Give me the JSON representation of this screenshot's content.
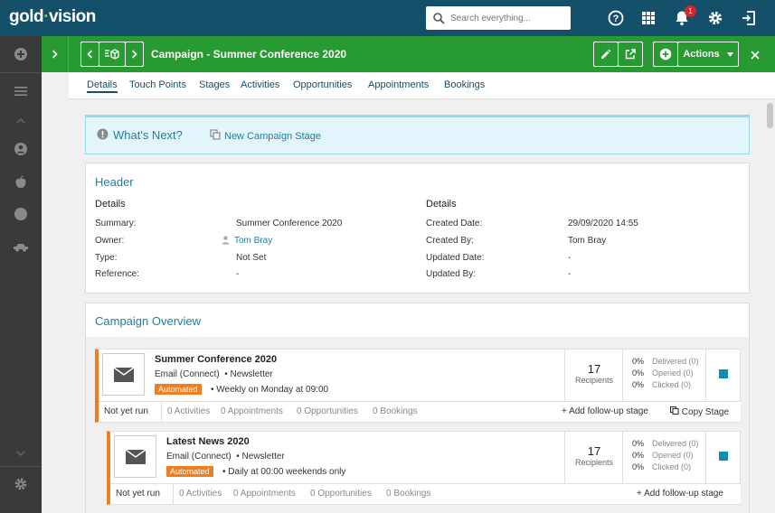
{
  "app": {
    "logo_part1": "gold",
    "logo_part2": "vision",
    "notification_count": "1"
  },
  "search": {
    "placeholder": "Search everything..."
  },
  "header": {
    "title": "Campaign - Summer Conference 2020",
    "actions_label": "Actions"
  },
  "tabs": [
    "Details",
    "Touch Points",
    "Stages",
    "Activities",
    "Opportunities",
    "Appointments",
    "Bookings"
  ],
  "whats_next": {
    "title": "What's Next?",
    "link": "New Campaign Stage"
  },
  "header_panel": {
    "title": "Header",
    "left": {
      "heading": "Details",
      "rows": [
        {
          "label": "Summary:",
          "value": "Summer Conference 2020"
        },
        {
          "label": "Owner:",
          "value": "Tom Bray"
        },
        {
          "label": "Type:",
          "value": "Not Set"
        },
        {
          "label": "Reference:",
          "value": "-"
        }
      ]
    },
    "right": {
      "heading": "Details",
      "rows": [
        {
          "label": "Created Date:",
          "value": "29/09/2020 14:55"
        },
        {
          "label": "Created By:",
          "value": "Tom Bray"
        },
        {
          "label": "Updated Date:",
          "value": "-"
        },
        {
          "label": "Updated By:",
          "value": "-"
        }
      ]
    }
  },
  "overview": {
    "title": "Campaign Overview",
    "stages": [
      {
        "name": "Summer Conference 2020",
        "type": "Email (Connect)",
        "list": "Newsletter",
        "badge": "Automated",
        "schedule": "Weekly on Monday at 09:00",
        "recipients": "17",
        "recipients_label": "Recipients",
        "delivered_pct": "0%",
        "delivered": "Delivered (0)",
        "opened_pct": "0%",
        "opened": "Opened (0)",
        "clicked_pct": "0%",
        "clicked": "Clicked (0)",
        "run_status": "Not yet run",
        "activities": "0 Activities",
        "appointments": "0 Appointments",
        "opportunities": "0 Opportunities",
        "bookings": "0 Bookings",
        "add_followup": "Add follow-up stage",
        "copy_stage": "Copy Stage"
      },
      {
        "name": "Latest News 2020",
        "type": "Email (Connect)",
        "list": "Newsletter",
        "badge": "Automated",
        "schedule": "Daily at 00:00 weekends only",
        "recipients": "17",
        "recipients_label": "Recipients",
        "delivered_pct": "0%",
        "delivered": "Delivered (0)",
        "opened_pct": "0%",
        "opened": "Opened (0)",
        "clicked_pct": "0%",
        "clicked": "Clicked (0)",
        "run_status": "Not yet run",
        "activities": "0 Activities",
        "appointments": "0 Appointments",
        "opportunities": "0 Opportunities",
        "bookings": "0 Bookings",
        "add_followup": "Add follow-up stage"
      }
    ]
  }
}
